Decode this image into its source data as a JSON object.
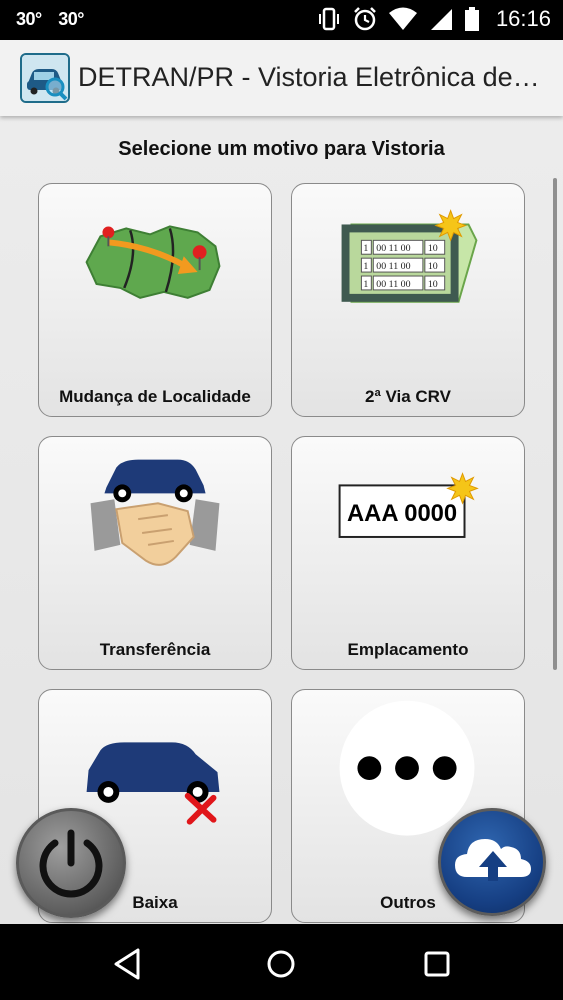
{
  "status_bar": {
    "left_indicators": [
      "30°",
      "30°"
    ],
    "icons": [
      "vibrate-icon",
      "alarm-icon",
      "wifi-icon",
      "signal-icon",
      "battery-icon"
    ],
    "time": "16:16"
  },
  "app_bar": {
    "title": "DETRAN/PR - Vistoria Eletrônica de…",
    "logo_icon": "car-magnifier-logo-icon"
  },
  "main": {
    "heading": "Selecione um motivo para Vistoria",
    "cards": [
      {
        "label": "Mudança de Localidade",
        "icon": "map-relocation-icon"
      },
      {
        "label": "2ª Via CRV",
        "icon": "crv-document-icon",
        "document_rows": [
          "1",
          "00 11 00",
          "10"
        ]
      },
      {
        "label": "Transferência",
        "icon": "handshake-car-icon"
      },
      {
        "label": "Emplacamento",
        "icon": "license-plate-icon",
        "plate_text": "AAA 0000"
      },
      {
        "label": "Baixa",
        "icon": "car-removal-icon"
      },
      {
        "label": "Outros",
        "icon": "more-dots-icon"
      }
    ]
  },
  "floating_buttons": {
    "power": "power-icon",
    "upload": "cloud-upload-icon"
  },
  "nav_bar": {
    "buttons": [
      "back-icon",
      "home-icon",
      "recents-icon"
    ]
  },
  "colors": {
    "status_bar": "#000000",
    "app_bar": "#f2f2f2",
    "content_bg": "#ececec",
    "car_blue": "#1e3a78",
    "upload_blue": "#163f83",
    "map_green": "#5fa84e"
  }
}
